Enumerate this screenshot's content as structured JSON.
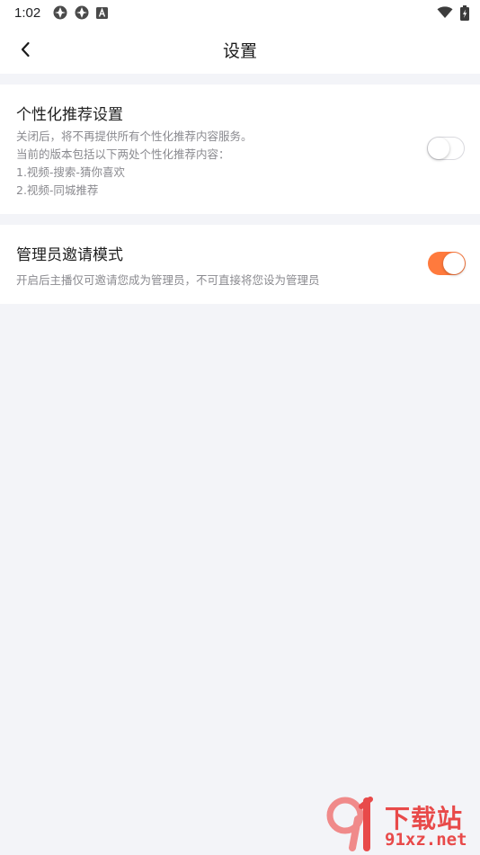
{
  "status_bar": {
    "time": "1:02",
    "left_icons": [
      "app-icon-1",
      "app-icon-2",
      "keyboard-a-icon"
    ],
    "right_icons": [
      "wifi-icon",
      "battery-charging-icon"
    ]
  },
  "header": {
    "back_icon": "chevron-left-icon",
    "title": "设置"
  },
  "sections": [
    {
      "title": "个性化推荐设置",
      "description_lines": [
        "关闭后，将不再提供所有个性化推荐内容服务。",
        "当前的版本包括以下两处个性化推荐内容：",
        "1.视频-搜索-猜你喜欢",
        "2.视频-同城推荐"
      ],
      "toggle_on": false
    },
    {
      "title": "管理员邀请模式",
      "description_lines": [
        "开启后主播仅可邀请您成为管理员，不可直接将您设为管理员"
      ],
      "toggle_on": true
    }
  ],
  "watermark": {
    "line1": "下载站",
    "line2": "91xz.net"
  },
  "colors": {
    "accent": "#ff7a3d",
    "background": "#f3f4f8",
    "card": "#ffffff",
    "text_primary": "#1f1f1f",
    "text_secondary": "#8a8a8f",
    "watermark": "#e84a4a"
  }
}
